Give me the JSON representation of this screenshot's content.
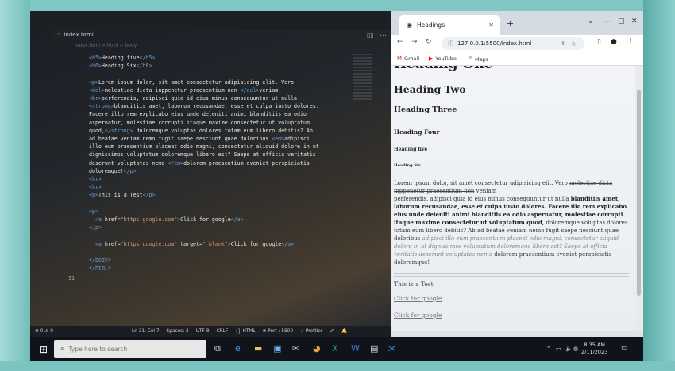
{
  "editor": {
    "tab_name": "index.html",
    "breadcrumb": "index.html > html > body",
    "code_lines": [
      "<h5>Heading five</h5>",
      "<h6>Heading Six</h6>",
      "",
      "<p>Lorem ipsum dolor, sit amet consectetur adipisicing elit. Vero",
      "<del>molestiae dicta inppenetur praesentium non </del>veniam",
      "<br>perferendis, adipisci quia id eius minus consequuntur ut nulla",
      "<strong>blanditiis amet, laborum recusandae, esse et culpa iusto dolores.",
      "Facere illo rem explicabo eius unde deleniti animi blanditiis ea odio",
      "aspernatur, molestiae corrupti itaque maxime consectetur ut voluptatum",
      "quod,</strong> doloremque voluptas dolores totam eum libero debitis? Ab",
      "ad beatae veniam nemo fugit saepe nesciunt quae doloribus <em>adipisci",
      "illo eum praesentium placeat odio magni, consectetur aliquid dolore in ut",
      "dignissimos voluptatum doloremque libero est? Saepe at officia veritatis",
      "deserunt voluptates nemo </em>dolorem praesentium eveniet perspiciatis",
      "doloremque!</p>",
      "<hr>",
      "<hr>",
      "<p>This is a Test</p>",
      "",
      "<p>",
      "  <a href=\"https:google.com\">Click for google</a>",
      "</p>",
      "",
      "  <a href=\"https:google.com\" target=\"_blank\">Click for google</a>",
      "",
      "</body>",
      "</html>"
    ],
    "line_number": "31"
  },
  "status_bar": {
    "errors": "⊗ 0 ⚠ 0",
    "position": "Ln 31, Col 7",
    "spaces": "Spaces: 2",
    "encoding": "UTF-8",
    "eol": "CRLF",
    "language": "{} HTML",
    "port": "⊘ Port : 5500",
    "prettier": "✓ Prettier"
  },
  "browser": {
    "tab_title": "Headings",
    "url": "127.0.0.1:5500/index.html",
    "bookmarks": [
      "Gmail",
      "YouTube",
      "Maps"
    ]
  },
  "page": {
    "h1": "Heading One",
    "h2": "Heading Two",
    "h3": "Heading Three",
    "h4": "Heading Four",
    "h5": "Heading five",
    "h6": "Heading Six",
    "para_plain1": "Lorem ipsum dolor, sit amet consectetur adipisicing elit. Vero ",
    "para_del": "molestiae dicta inppenetur praesentium non",
    "para_plain2": " veniam",
    "para_plain3": "perferendis, adipisci quia id eius minus consequuntur ut nulla ",
    "para_strong": "blanditiis amet, laborum recusandae, esse et culpa iusto dolores. Facere illo rem explicabo eius unde deleniti animi blanditiis ea odio aspernatur, molestiae corrupti itaque maxime consectetur ut voluptatum quod,",
    "para_plain4": " doloremque voluptas dolores totam eum libero debitis? Ab ad beatae veniam nemo fugit saepe nesciunt quae doloribus ",
    "para_em": "adipisci illo eum praesentium placeat odio magni, consectetur aliquid dolore in ut dignissimos voluptatum doloremque libero est? Saepe at officia veritatis deserunt voluptates nemo",
    "para_plain5": " dolorem praesentium eveniet perspiciatis doloremque!",
    "test_text": "This is a Test",
    "link1": "Click for google",
    "link2": "Click for google"
  },
  "taskbar": {
    "search_placeholder": "Type here to search",
    "time": "8:35 AM",
    "date": "2/11/2023"
  }
}
